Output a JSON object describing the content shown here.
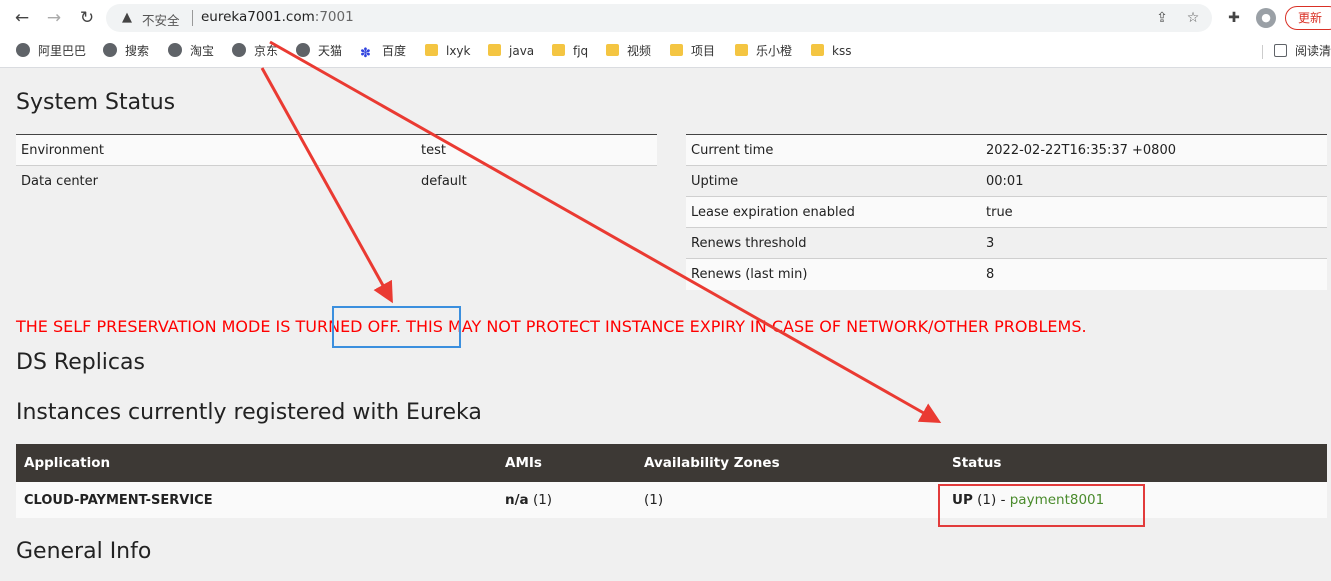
{
  "browser": {
    "insecure_label": "不安全",
    "url_host": "eureka7001.com",
    "url_port": ":7001",
    "update_label": "更新",
    "bookmarks": [
      {
        "label": "阿里巴巴",
        "icon": "globe-icon"
      },
      {
        "label": "搜索",
        "icon": "globe-icon"
      },
      {
        "label": "淘宝",
        "icon": "globe-icon"
      },
      {
        "label": "京东",
        "icon": "globe-icon"
      },
      {
        "label": "天猫",
        "icon": "globe-icon"
      },
      {
        "label": "百度",
        "icon": "baidu-paw-icon"
      },
      {
        "label": "lxyk",
        "icon": "folder-icon"
      },
      {
        "label": "java",
        "icon": "folder-icon"
      },
      {
        "label": "fjq",
        "icon": "folder-icon"
      },
      {
        "label": "视频",
        "icon": "folder-icon"
      },
      {
        "label": "项目",
        "icon": "folder-icon"
      },
      {
        "label": "乐小橙",
        "icon": "folder-icon"
      },
      {
        "label": "kss",
        "icon": "folder-icon"
      }
    ],
    "reading_list_label": "阅读清"
  },
  "system_status": {
    "title": "System Status",
    "left_table": [
      {
        "key": "Environment",
        "value": "test"
      },
      {
        "key": "Data center",
        "value": "default"
      }
    ],
    "right_table": [
      {
        "key": "Current time",
        "value": "2022-02-22T16:35:37 +0800"
      },
      {
        "key": "Uptime",
        "value": "00:01"
      },
      {
        "key": "Lease expiration enabled",
        "value": "true"
      },
      {
        "key": "Renews threshold",
        "value": "3"
      },
      {
        "key": "Renews (last min)",
        "value": "8"
      }
    ]
  },
  "warning": "THE SELF PRESERVATION MODE IS TURNED OFF. THIS MAY NOT PROTECT INSTANCE EXPIRY IN CASE OF NETWORK/OTHER PROBLEMS.",
  "ds_replicas_title": "DS Replicas",
  "instances": {
    "title": "Instances currently registered with Eureka",
    "columns": [
      "Application",
      "AMIs",
      "Availability Zones",
      "Status"
    ],
    "rows": [
      {
        "application": "CLOUD-PAYMENT-SERVICE",
        "amis_bold": "n/a",
        "amis_count": " (1)",
        "zones": "(1)",
        "status_bold": "UP",
        "status_count": " (1) - ",
        "status_link": "payment8001"
      }
    ]
  },
  "general_info_title": "General Info",
  "colors": {
    "warning": "#ff0000",
    "table_header": "#3d3935",
    "link": "#4a8b2c",
    "annotation_red": "#e23b3b",
    "annotation_blue": "#3b8fde"
  }
}
